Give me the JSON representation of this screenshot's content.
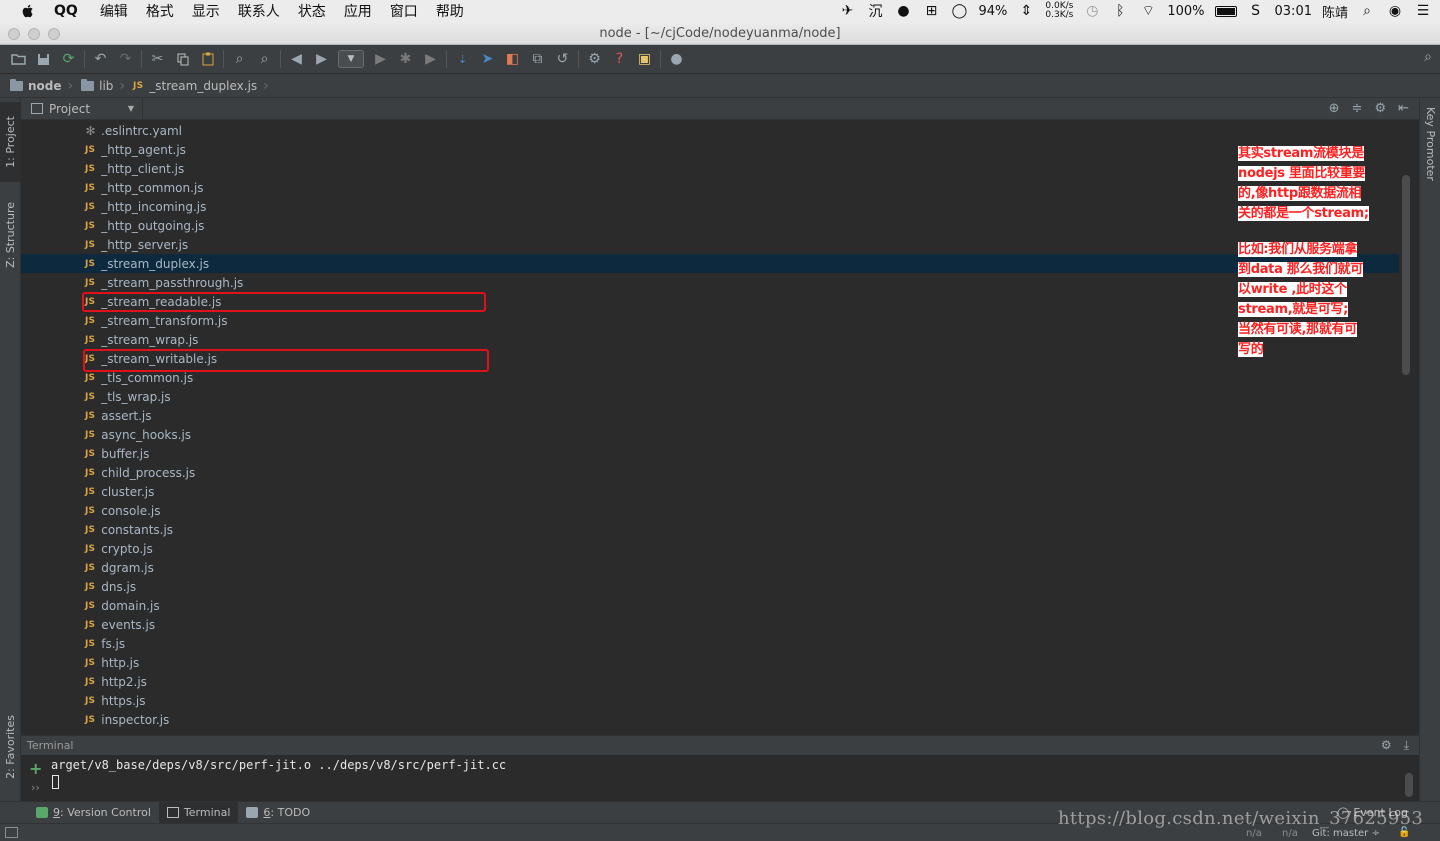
{
  "menubar": {
    "app_name": "QQ",
    "items": [
      "编辑",
      "格式",
      "显示",
      "联系人",
      "状态",
      "应用",
      "窗口",
      "帮助"
    ],
    "battery_cpu": "94%",
    "net_up": "0.0K/s",
    "net_down": "0.3K/s",
    "battery": "100%",
    "time": "03:01",
    "user": "陈靖"
  },
  "window": {
    "title": "node - [~/cjCode/nodeyuanma/node]"
  },
  "breadcrumb": {
    "items": [
      "node",
      "lib",
      "_stream_duplex.js"
    ],
    "file_badge": "JS"
  },
  "left_tabs": {
    "project": "1: Project",
    "structure": "Z: Structure",
    "favorites": "2: Favorites"
  },
  "right_tabs": {
    "key_promoter": "Key Promoter"
  },
  "project_panel": {
    "title": "Project"
  },
  "file_badge": "JS",
  "files": [
    ".eslintrc.yaml",
    "_http_agent.js",
    "_http_client.js",
    "_http_common.js",
    "_http_incoming.js",
    "_http_outgoing.js",
    "_http_server.js",
    "_stream_duplex.js",
    "_stream_passthrough.js",
    "_stream_readable.js",
    "_stream_transform.js",
    "_stream_wrap.js",
    "_stream_writable.js",
    "_tls_common.js",
    "_tls_wrap.js",
    "assert.js",
    "async_hooks.js",
    "buffer.js",
    "child_process.js",
    "cluster.js",
    "console.js",
    "constants.js",
    "crypto.js",
    "dgram.js",
    "dns.js",
    "domain.js",
    "events.js",
    "fs.js",
    "http.js",
    "http2.js",
    "https.js",
    "inspector.js"
  ],
  "selected_file": "_stream_duplex.js",
  "highlighted_files": [
    "_stream_readable.js",
    "_stream_writable.js"
  ],
  "annotation": {
    "lines_1": [
      "其实stream流模块是",
      "nodejs 里面比较重要",
      "的,像http跟数据流相",
      "关的都是一个stream;"
    ],
    "lines_2": [
      "比如:我们从服务端拿",
      "到data  那么我们就可",
      "以write ,此时这个",
      "stream,就是可写;",
      "当然有可读,那就有可",
      "写的"
    ]
  },
  "terminal": {
    "title": "Terminal",
    "line": "arget/v8_base/deps/v8/src/perf-jit.o ../deps/v8/src/perf-jit.cc",
    "chevrons": "››"
  },
  "bottom_tabs": {
    "version_control_key": "9",
    "version_control": ": Version Control",
    "terminal": "Terminal",
    "todo_key": "6",
    "todo": ": TODO",
    "event_log": "Event Log"
  },
  "statusbar": {
    "na1": "n/a",
    "na2": "n/a",
    "git": "Git: master ÷"
  },
  "watermark": "https://blog.csdn.net/weixin_37625953",
  "colors": {
    "annotation_red": "#ff2020",
    "highlight_red": "#e0111b",
    "js_badge": "#d9a441",
    "selection": "#0d293e"
  }
}
